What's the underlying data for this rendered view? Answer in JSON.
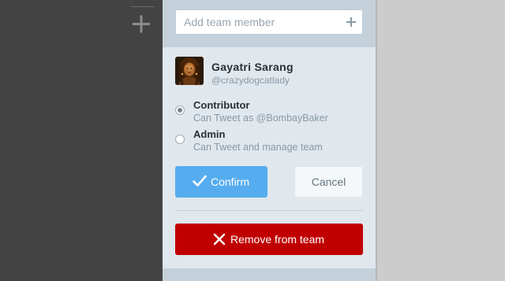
{
  "search": {
    "placeholder": "Add team member",
    "add_icon": "plus-icon"
  },
  "left_column": {
    "add_icon": "plus-icon"
  },
  "member": {
    "name": "Gayatri Sarang",
    "handle": "@crazydogcatlady",
    "avatar": "profile-photo"
  },
  "roles": [
    {
      "title": "Contributor",
      "description": "Can Tweet as @BombayBaker",
      "selected": true
    },
    {
      "title": "Admin",
      "description": "Can Tweet and manage team",
      "selected": false
    }
  ],
  "actions": {
    "confirm_label": "Confirm",
    "confirm_icon": "checkmark-icon",
    "cancel_label": "Cancel",
    "remove_label": "Remove from team",
    "remove_icon": "close-x-icon"
  },
  "colors": {
    "primary": "#55acee",
    "danger": "#c00000",
    "panel_background": "#e0e7ed",
    "sidebar_background": "#434343"
  }
}
